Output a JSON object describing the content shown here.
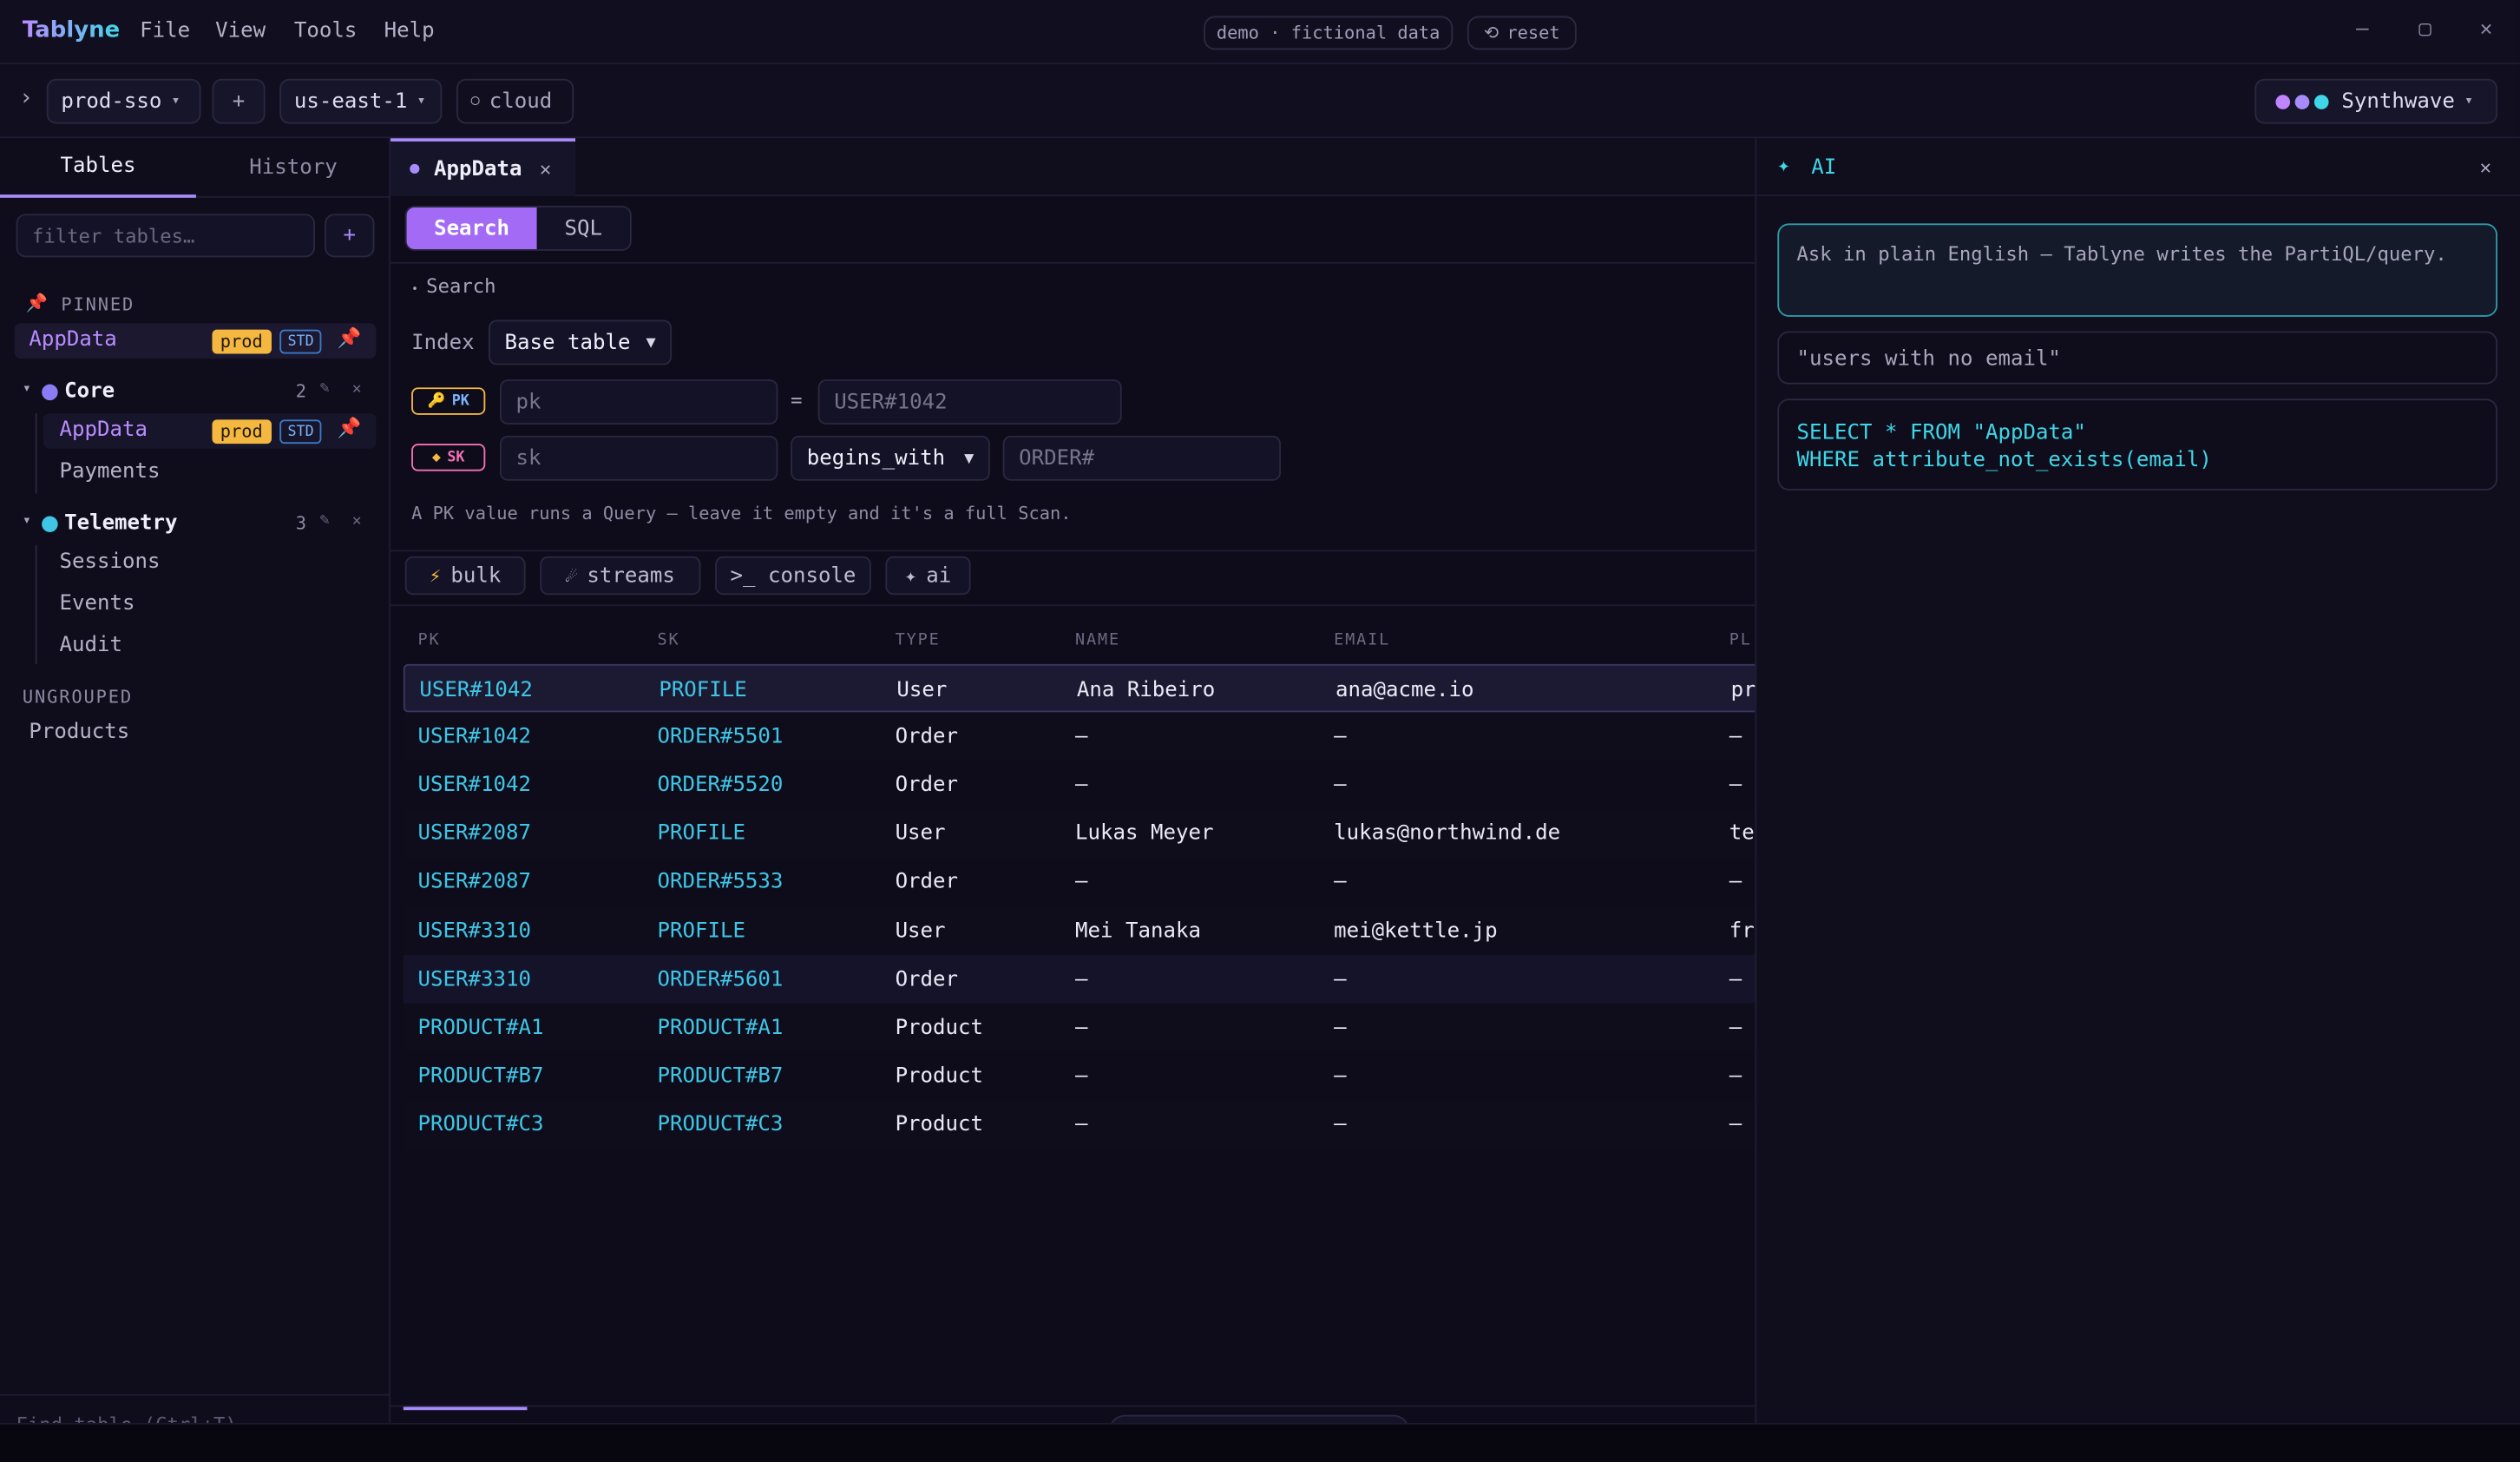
{
  "app": {
    "name": "Tablyne"
  },
  "menu": [
    "File",
    "View",
    "Tools",
    "Help"
  ],
  "titlebar": {
    "demo_badge": "demo · fictional data",
    "reset_label": "reset"
  },
  "toolbar": {
    "profile": "prod-sso",
    "add": "+",
    "region": "us-east-1",
    "cloud": "cloud",
    "theme": "Synthwave"
  },
  "sidebar": {
    "tabs": [
      "Tables",
      "History"
    ],
    "filter_placeholder": "filter tables…",
    "add": "+",
    "pinned_label": "PINNED",
    "pinned_item": {
      "name": "AppData",
      "env": "prod",
      "class": "STD"
    },
    "groups": [
      {
        "name": "Core",
        "count": "2",
        "color": "#8b7cf6",
        "items": [
          {
            "name": "AppData",
            "env": "prod",
            "class": "STD"
          },
          {
            "name": "Payments"
          }
        ]
      },
      {
        "name": "Telemetry",
        "count": "3",
        "color": "#3fc6e6",
        "items": [
          {
            "name": "Sessions"
          },
          {
            "name": "Events"
          },
          {
            "name": "Audit"
          }
        ]
      }
    ],
    "ungrouped_label": "UNGROUPED",
    "ungrouped_items": [
      "Products"
    ],
    "find_hint": "Find table (Ctrl+T)"
  },
  "editor": {
    "tab": "AppData",
    "modes": [
      "Search",
      "SQL"
    ],
    "section": "Search",
    "index_label": "Index",
    "index_value": "Base table",
    "pk_tag": "PK",
    "sk_tag": "SK",
    "pk_name": "pk",
    "pk_op": "=",
    "pk_value": "USER#1042",
    "sk_name": "sk",
    "sk_op": "begins_with",
    "sk_value": "ORDER#",
    "hint": "A PK value runs a Query — leave it empty and it's a full Scan.",
    "actions": [
      "bulk",
      "streams",
      ">_ console",
      "ai"
    ]
  },
  "table": {
    "columns": [
      "PK",
      "SK",
      "TYPE",
      "NAME",
      "EMAIL",
      "PL"
    ],
    "rows": [
      [
        "USER#1042",
        "PROFILE",
        "User",
        "Ana Ribeiro",
        "ana@acme.io",
        "pr"
      ],
      [
        "USER#1042",
        "ORDER#5501",
        "Order",
        "—",
        "—",
        "—"
      ],
      [
        "USER#1042",
        "ORDER#5520",
        "Order",
        "—",
        "—",
        "—"
      ],
      [
        "USER#2087",
        "PROFILE",
        "User",
        "Lukas Meyer",
        "lukas@northwind.de",
        "te"
      ],
      [
        "USER#2087",
        "ORDER#5533",
        "Order",
        "—",
        "—",
        "—"
      ],
      [
        "USER#3310",
        "PROFILE",
        "User",
        "Mei Tanaka",
        "mei@kettle.jp",
        "fr"
      ],
      [
        "USER#3310",
        "ORDER#5601",
        "Order",
        "—",
        "—",
        "—"
      ],
      [
        "PRODUCT#A1",
        "PRODUCT#A1",
        "Product",
        "—",
        "—",
        "—"
      ],
      [
        "PRODUCT#B7",
        "PRODUCT#B7",
        "Product",
        "—",
        "—",
        "—"
      ],
      [
        "PRODUCT#C3",
        "PRODUCT#C3",
        "Product",
        "—",
        "—",
        "—"
      ]
    ]
  },
  "ai": {
    "title": "AI",
    "intro": "Ask in plain English — Tablyne writes the PartiQL/query.",
    "prompt": "\"users with no email\"",
    "query_line1": "SELECT * FROM \"AppData\"",
    "query_line2": "WHERE attribute_not_exists(email)"
  },
  "colors": {
    "accent": "#a78bfa",
    "cyan": "#3fc6e6",
    "prod": "#f4b740",
    "pink": "#f472b6"
  }
}
